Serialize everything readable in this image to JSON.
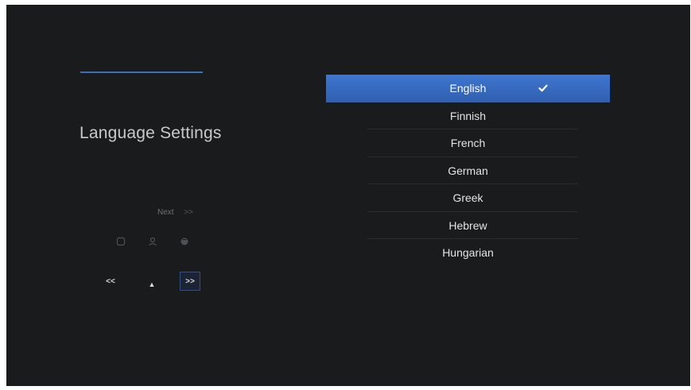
{
  "header": {
    "setup_progress": 1.0,
    "accent_color": "#3d6fb8"
  },
  "page": {
    "title": "Language Settings"
  },
  "hint": {
    "next_label": "Next",
    "next_chevron": ">>"
  },
  "remote_icons": [
    "remote-key-icon",
    "remote-person-icon",
    "remote-home-icon"
  ],
  "navigation": {
    "prev_label": "<<",
    "up_label": "▲",
    "next_label": ">>"
  },
  "languages": {
    "selected": "English",
    "items": [
      {
        "label": "English"
      },
      {
        "label": "Finnish"
      },
      {
        "label": "French"
      },
      {
        "label": "German"
      },
      {
        "label": "Greek"
      },
      {
        "label": "Hebrew"
      },
      {
        "label": "Hungarian"
      }
    ]
  }
}
